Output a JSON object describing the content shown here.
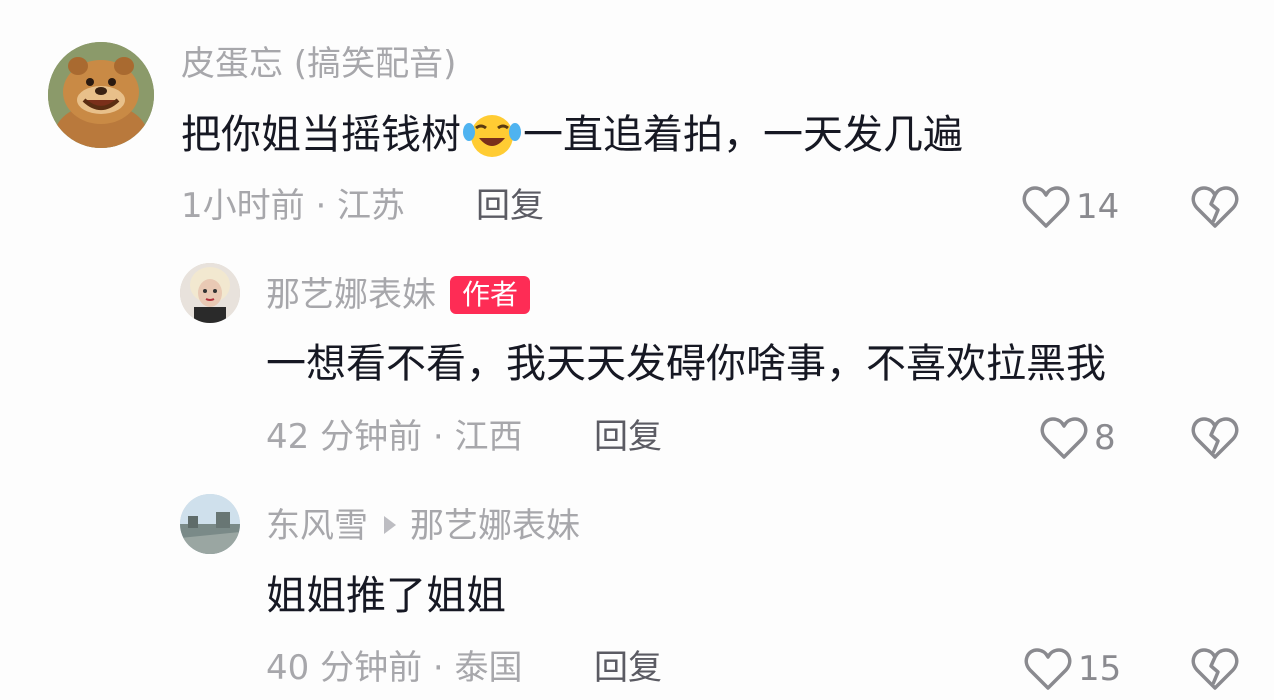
{
  "comments": [
    {
      "username": "皮蛋忘 (搞笑配音)",
      "text_before_emoji": "把你姐当摇钱树",
      "emoji": "crying-laughing-emoji",
      "text_after_emoji": "一直追着拍，一天发几遍",
      "meta": "1小时前 · 江苏",
      "reply_label": "回复",
      "likes": "14"
    },
    {
      "username": "那艺娜表妹",
      "badge": "作者",
      "text": "一想看不看，我天天发碍你啥事，不喜欢拉黑我",
      "meta": "42 分钟前 · 江西",
      "reply_label": "回复",
      "likes": "8"
    },
    {
      "username": "东风雪",
      "reply_to": "那艺娜表妹",
      "text": "姐姐推了姐姐",
      "meta": "40 分钟前 · 泰国",
      "reply_label": "回复",
      "likes": "15"
    }
  ],
  "colors": {
    "badge": "#fe2c55",
    "username": "#a7a7ab",
    "text": "#161823",
    "reply": "#5b5b63"
  }
}
